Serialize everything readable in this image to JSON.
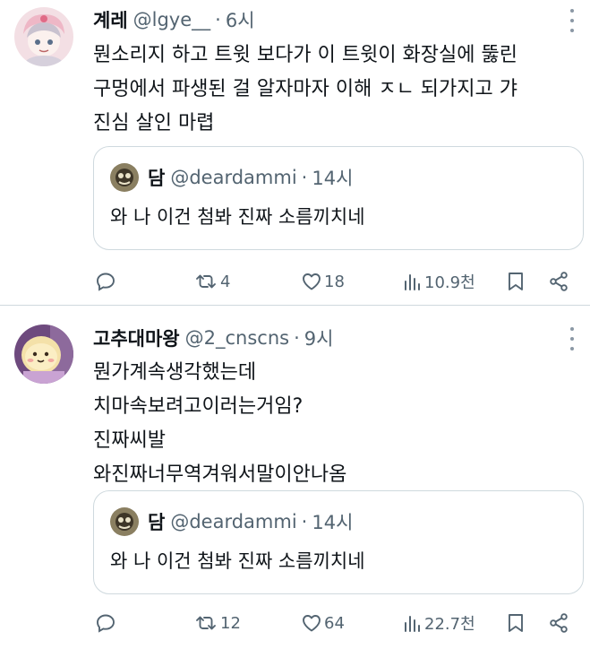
{
  "tweets": [
    {
      "author": {
        "name": "계레",
        "handle": "@lgye__",
        "time": "6시"
      },
      "text_lines": [
        "뭔소리지 하고 트윗 보다가 이 트윗이 화장실에 뚫린",
        "구멍에서 파생된 걸 알자마자 이해 ㅈㄴ 되가지고 갸",
        "진심 살인 마렵"
      ],
      "quote": {
        "name": "담",
        "handle": "@deardammi",
        "time": "14시",
        "text": "와 나 이건 첨봐 진짜 소름끼치네"
      },
      "stats": {
        "replies": "",
        "retweets": "4",
        "likes": "18",
        "views": "10.9천"
      }
    },
    {
      "author": {
        "name": "고추대마왕",
        "handle": "@2_cnscns",
        "time": "9시"
      },
      "text_lines": [
        "뭔가계속생각했는데",
        "치마속보려고이러는거임?",
        "진짜씨발",
        "와진짜너무역겨워서말이안나옴"
      ],
      "quote": {
        "name": "담",
        "handle": "@deardammi",
        "time": "14시",
        "text": "와 나 이건 첨봐 진짜 소름끼치네"
      },
      "stats": {
        "replies": "",
        "retweets": "12",
        "likes": "64",
        "views": "22.7천"
      }
    }
  ],
  "colors": {
    "text": "#0f1419",
    "secondary": "#536471",
    "border": "#cfd9de"
  },
  "icons": [
    "reply-icon",
    "retweet-icon",
    "like-icon",
    "views-icon",
    "bookmark-icon",
    "share-icon",
    "more-icon"
  ]
}
